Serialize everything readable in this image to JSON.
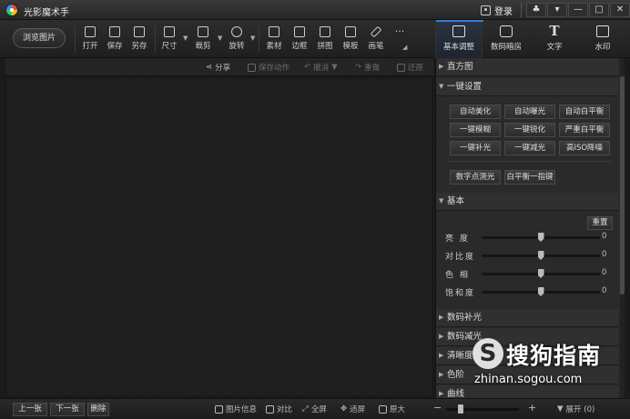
{
  "window": {
    "title": "光影魔术手",
    "login": "登录",
    "controls": [
      "♣",
      "▾",
      "—",
      "□",
      "✕"
    ]
  },
  "toolbar": {
    "browse": "浏览图片",
    "tools": [
      {
        "label": "打开",
        "icon": "open-icon"
      },
      {
        "label": "保存",
        "icon": "save-icon"
      },
      {
        "label": "另存",
        "icon": "save-as-icon"
      },
      {
        "label": "尺寸",
        "icon": "resize-icon"
      },
      {
        "label": "裁剪",
        "icon": "crop-icon"
      },
      {
        "label": "旋转",
        "icon": "rotate-icon"
      },
      {
        "label": "素材",
        "icon": "material-icon"
      },
      {
        "label": "边框",
        "icon": "border-icon"
      },
      {
        "label": "拼图",
        "icon": "collage-icon"
      },
      {
        "label": "模板",
        "icon": "template-icon"
      },
      {
        "label": "画笔",
        "icon": "brush-icon"
      }
    ],
    "more": "···"
  },
  "right_tabs": [
    {
      "label": "基本调整",
      "icon": "adjust-icon"
    },
    {
      "label": "数码暗房",
      "icon": "camera-icon"
    },
    {
      "label": "文字",
      "icon": "text-icon"
    },
    {
      "label": "水印",
      "icon": "watermark-icon"
    }
  ],
  "subbar": {
    "share": "分享",
    "save_action": "保存动作",
    "undo": "撤消",
    "redo": "重做",
    "restore": "还原"
  },
  "panel": {
    "histogram": "直方图",
    "one_click": "一键设置",
    "buttons": [
      [
        "自动美化",
        "自动曝光",
        "自动白平衡"
      ],
      [
        "一键模糊",
        "一键锐化",
        "严重白平衡"
      ],
      [
        "一键补光",
        "一键减光",
        "高ISO降噪"
      ]
    ],
    "extra_buttons": [
      "数字点测光",
      "白平衡一指键"
    ],
    "basic": "基本",
    "reset": "重置",
    "sliders": [
      {
        "label": "亮 度",
        "value": "0",
        "level": 0.5
      },
      {
        "label": "对比度",
        "value": "0",
        "level": 0.5
      },
      {
        "label": "色 相",
        "value": "0",
        "level": 0.5
      },
      {
        "label": "饱和度",
        "value": "0",
        "level": 0.5
      }
    ],
    "sections": [
      "数码补光",
      "数码减光",
      "清晰度",
      "色阶",
      "曲线"
    ]
  },
  "statusbar": {
    "prev": "上一张",
    "next": "下一张",
    "delete": "删除",
    "info": "图片信息",
    "compare": "对比",
    "fullscreen": "全屏",
    "fit": "适屏",
    "original": "原大",
    "zoom_minus": "−",
    "zoom_plus": "+",
    "zoom_level": 0.2,
    "expand": "展开 (0)"
  },
  "watermark": {
    "logo": "S",
    "text": "搜狗指南",
    "url": "zhinan.sogou.com"
  }
}
